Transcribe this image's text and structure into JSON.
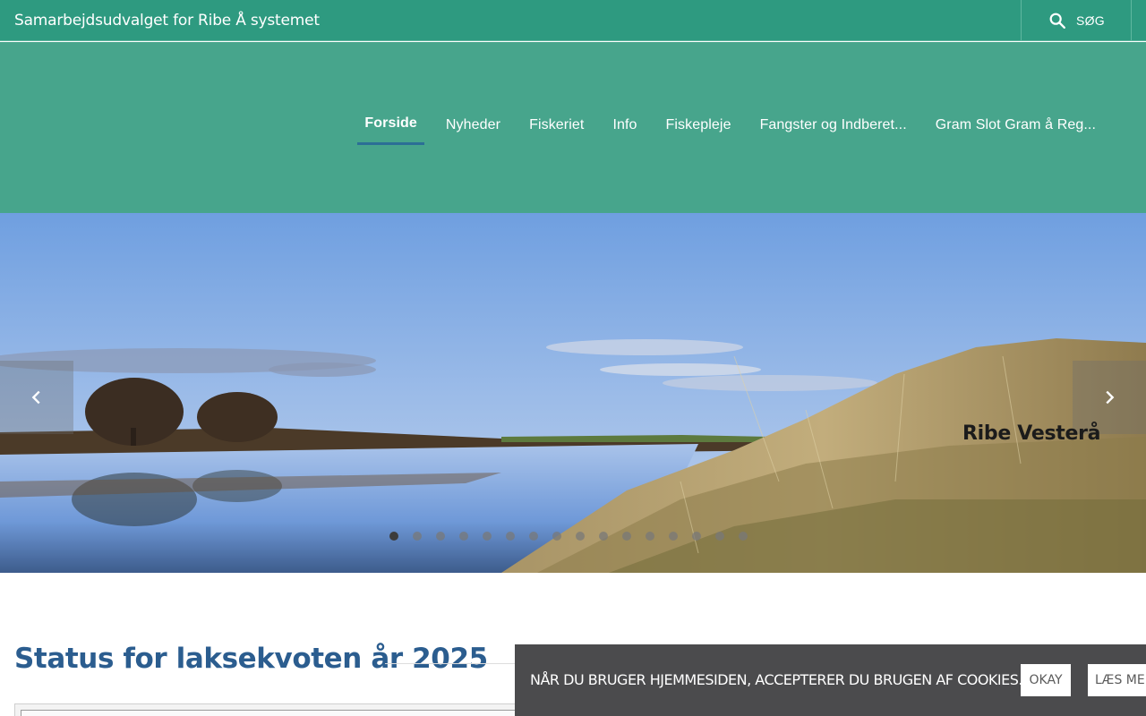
{
  "header": {
    "site_title": "Samarbejdsudvalget for Ribe Å systemet",
    "search_label": "SØG",
    "search_icon": "search-icon"
  },
  "nav": {
    "items": [
      {
        "label": "Forside",
        "active": true
      },
      {
        "label": "Nyheder"
      },
      {
        "label": "Fiskeriet"
      },
      {
        "label": "Info"
      },
      {
        "label": "Fiskepleje"
      },
      {
        "label": "Fangster og Indberet..."
      },
      {
        "label": "Gram Slot Gram å Reg..."
      }
    ]
  },
  "slider": {
    "caption": "Ribe Vesterå",
    "prev_icon": "chevron-left-icon",
    "next_icon": "chevron-right-icon",
    "slide_count": 16,
    "active_slide": 1
  },
  "main": {
    "section_title": "Status for laksekvoten år 2025"
  },
  "cookie": {
    "text": "NÅR DU BRUGER HJEMMESIDEN, ACCEPTERER DU BRUGEN AF COOKIES.",
    "ok_label": "OKAY",
    "more_label": "LÆS MERE"
  },
  "colors": {
    "topbar": "#2e9a80",
    "navband": "#47a58c",
    "title_blue": "#2b5d8f",
    "cookie_bg": "#4b4b4d"
  }
}
